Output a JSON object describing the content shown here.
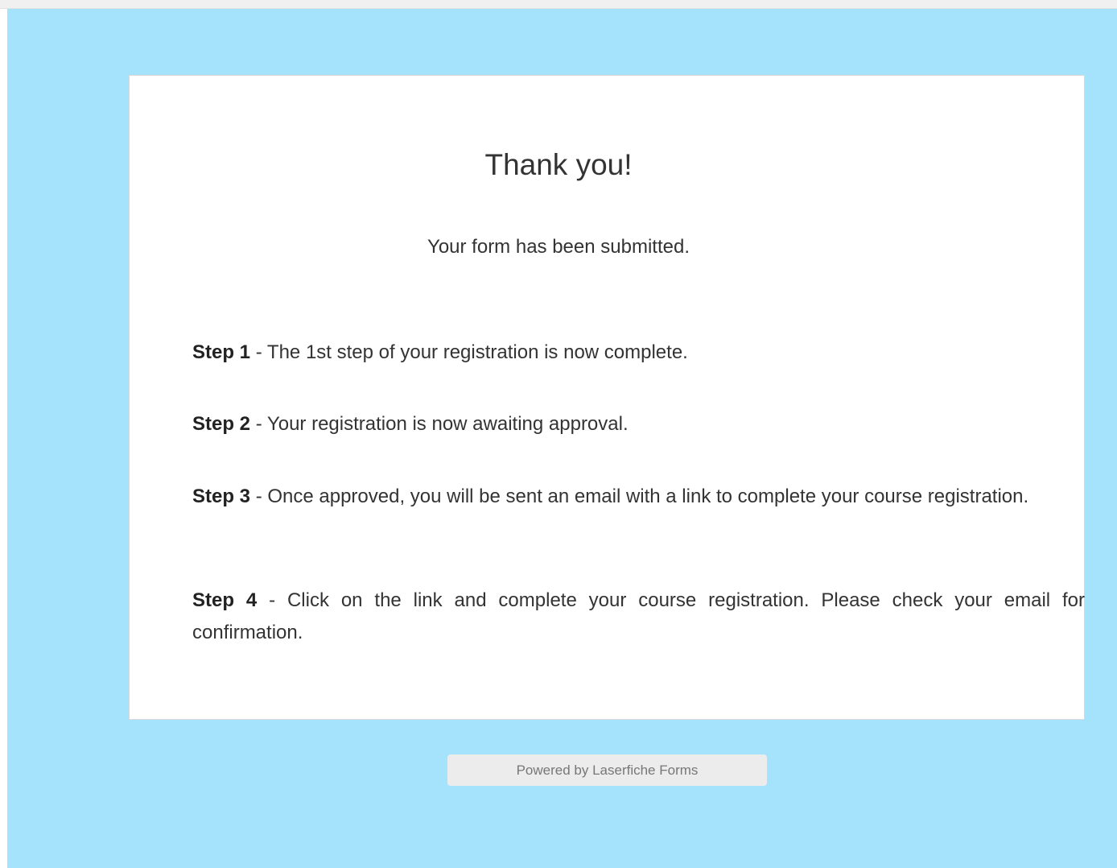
{
  "title": "Thank you!",
  "subtitle": "Your form has been submitted.",
  "steps": [
    {
      "label": "Step 1",
      "text": " - The 1st step of your registration is now complete."
    },
    {
      "label": "Step 2",
      "text": " - Your registration is now awaiting approval."
    },
    {
      "label": "Step 3",
      "text": " - Once approved, you will be sent an email with a link to complete your course registration."
    },
    {
      "label": "Step 4",
      "text": " - Click on the link and complete your course registration. Please check your email for confirmation."
    }
  ],
  "footer": "Powered by Laserfiche Forms",
  "colors": {
    "background": "#a5e3fd",
    "card": "#ffffff",
    "footer_bg": "#ececec",
    "text": "#333333"
  }
}
